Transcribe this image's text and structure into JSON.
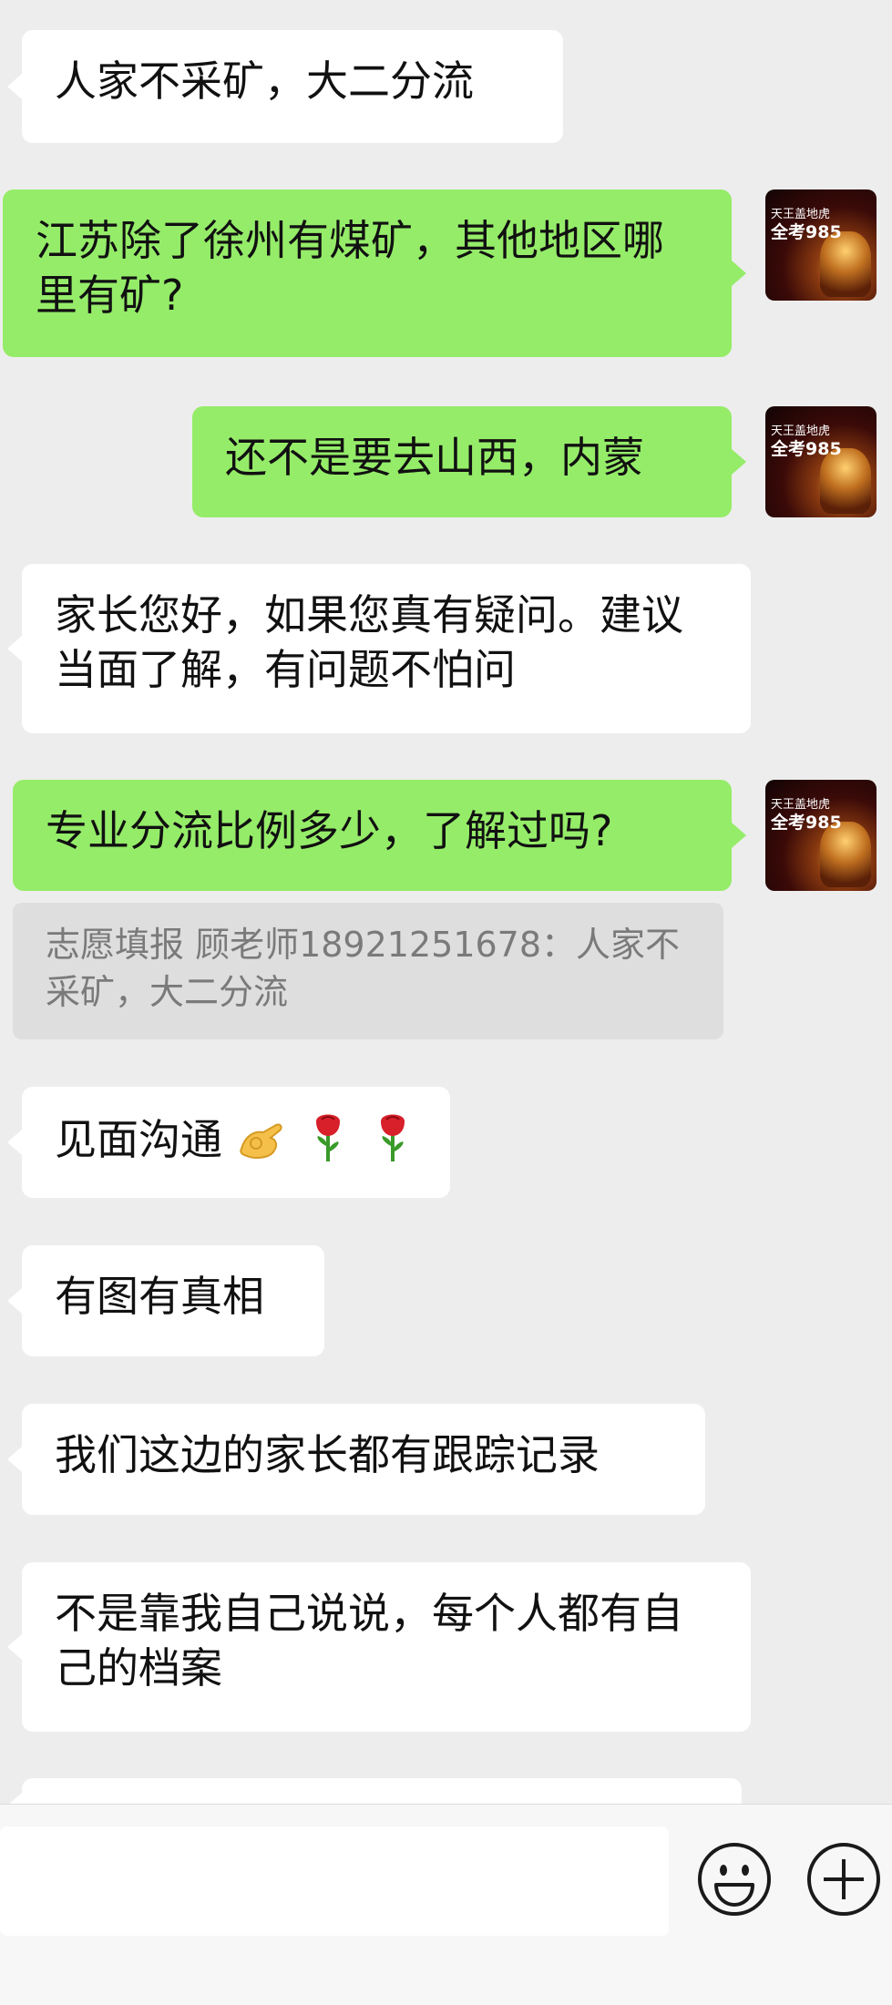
{
  "messages": [
    {
      "side": "left",
      "text": "人家不采矿，大二分流"
    },
    {
      "side": "right",
      "text": "江苏除了徐州有煤矿，其他地区哪里有矿?"
    },
    {
      "side": "right",
      "text": "还不是要去山西，内蒙"
    },
    {
      "side": "left",
      "text": "家长您好，如果您真有疑问。建议当面了解，有问题不怕问"
    },
    {
      "side": "right",
      "text": "专业分流比例多少，了解过吗?"
    },
    {
      "side": "quote",
      "text": "志愿填报 顾老师18921251678：人家不采矿，大二分流"
    },
    {
      "side": "left",
      "text": "见面沟通"
    },
    {
      "side": "left",
      "text": "有图有真相"
    },
    {
      "side": "left",
      "text": "我们这边的家长都有跟踪记录"
    },
    {
      "side": "left",
      "text": "不是靠我自己说说，每个人都有自己的档案"
    }
  ],
  "avatar": {
    "line1": "天王盖地虎",
    "line2": "全考985"
  },
  "emojis": [
    "ok-hand-emoji",
    "rose-emoji",
    "rose-emoji"
  ],
  "input": {
    "value": "",
    "placeholder": ""
  },
  "icons": {
    "emoji_button": "smiley-icon",
    "plus_button": "plus-circle-icon"
  },
  "colors": {
    "background": "#ededed",
    "bubble_self": "#95ec69",
    "bubble_other": "#ffffff",
    "quote_bg": "#dedede"
  }
}
